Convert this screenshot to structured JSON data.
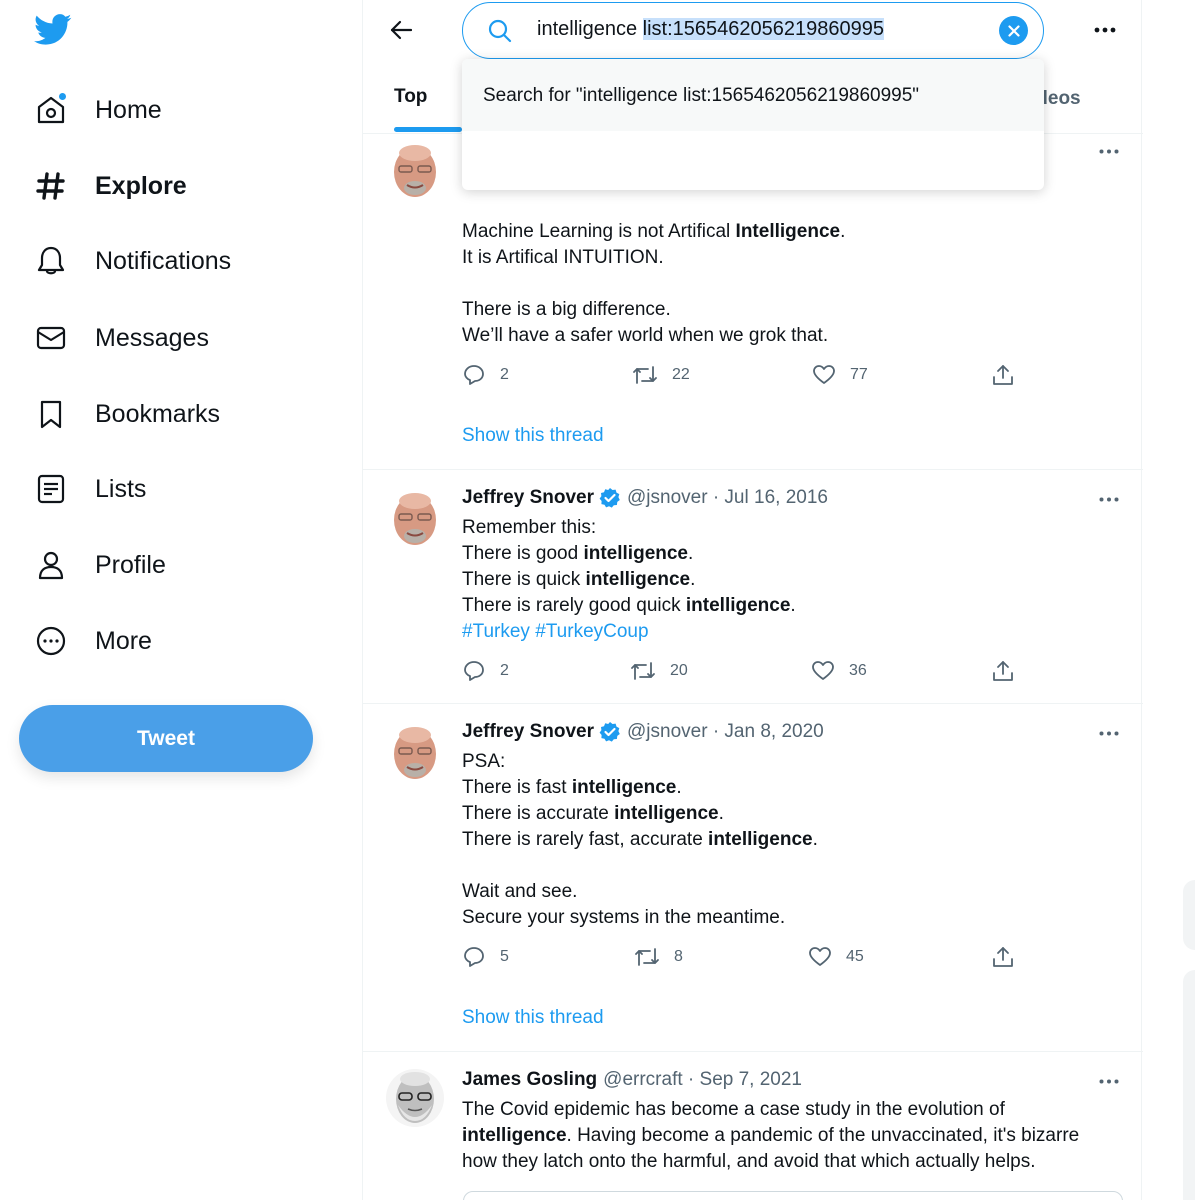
{
  "sidebar": {
    "logo": "twitter-bird-icon",
    "items": [
      {
        "label": "Home",
        "icon": "home-icon",
        "has_notification_dot": true
      },
      {
        "label": "Explore",
        "icon": "hashtag-icon",
        "active": true
      },
      {
        "label": "Notifications",
        "icon": "bell-icon"
      },
      {
        "label": "Messages",
        "icon": "envelope-icon"
      },
      {
        "label": "Bookmarks",
        "icon": "bookmark-icon"
      },
      {
        "label": "Lists",
        "icon": "list-icon"
      },
      {
        "label": "Profile",
        "icon": "person-icon"
      },
      {
        "label": "More",
        "icon": "more-circle-icon"
      }
    ],
    "tweet_button": "Tweet"
  },
  "search": {
    "query_plain": "intelligence ",
    "query_selected": "list:1565462056219860995",
    "suggestion": "Search for \"intelligence list:1565462056219860995\""
  },
  "tabs": {
    "active": "Top",
    "partial_visible": "ideos"
  },
  "tweets": [
    {
      "avatar": "jeffrey-snover-avatar",
      "lines": [
        [
          "Machine Learning is not Artifical ",
          {
            "b": "Intelligence"
          },
          "."
        ],
        [
          "It is Artifical INTUITION."
        ],
        [],
        [
          "There is a big difference."
        ],
        [
          "We’ll have a safer world when we grok that."
        ]
      ],
      "replies": "2",
      "retweets": "22",
      "likes": "77",
      "show_thread": "Show this thread"
    },
    {
      "name": "Jeffrey Snover",
      "verified": true,
      "handle": "@jsnover · Jul 16, 2016",
      "lines": [
        [
          "Remember this:"
        ],
        [
          "There is good ",
          {
            "b": "intelligence"
          },
          "."
        ],
        [
          "There is quick ",
          {
            "b": "intelligence"
          },
          "."
        ],
        [
          "There is rarely good quick ",
          {
            "b": "intelligence"
          },
          "."
        ],
        [
          {
            "tag": "#Turkey"
          },
          " ",
          {
            "tag": "#TurkeyCoup"
          }
        ]
      ],
      "replies": "2",
      "retweets": "20",
      "likes": "36"
    },
    {
      "name": "Jeffrey Snover",
      "verified": true,
      "handle": "@jsnover · Jan 8, 2020",
      "lines": [
        [
          "PSA:"
        ],
        [
          "There is fast ",
          {
            "b": "intelligence"
          },
          "."
        ],
        [
          "There is accurate ",
          {
            "b": "intelligence"
          },
          "."
        ],
        [
          "There is rarely fast, accurate ",
          {
            "b": "intelligence"
          },
          "."
        ],
        [],
        [
          "Wait and see."
        ],
        [
          "Secure your systems in the meantime."
        ]
      ],
      "replies": "5",
      "retweets": "8",
      "likes": "45",
      "show_thread": "Show this thread"
    },
    {
      "name": "James Gosling",
      "verified": false,
      "handle": "@errcraft · Sep 7, 2021",
      "lines": [
        [
          "The Covid epidemic has become a case study in the evolution of"
        ],
        [
          {
            "b": "intelligence"
          },
          ".  Having become a pandemic of the unvaccinated, it's bizarre"
        ],
        [
          "how they latch onto the harmful, and avoid that which actually helps."
        ]
      ]
    }
  ],
  "colors": {
    "accent": "#1d9bf0",
    "tweet_button": "#4a9fe8",
    "text": "#0f1419",
    "muted": "#536471",
    "selection": "#c7e0fb"
  }
}
